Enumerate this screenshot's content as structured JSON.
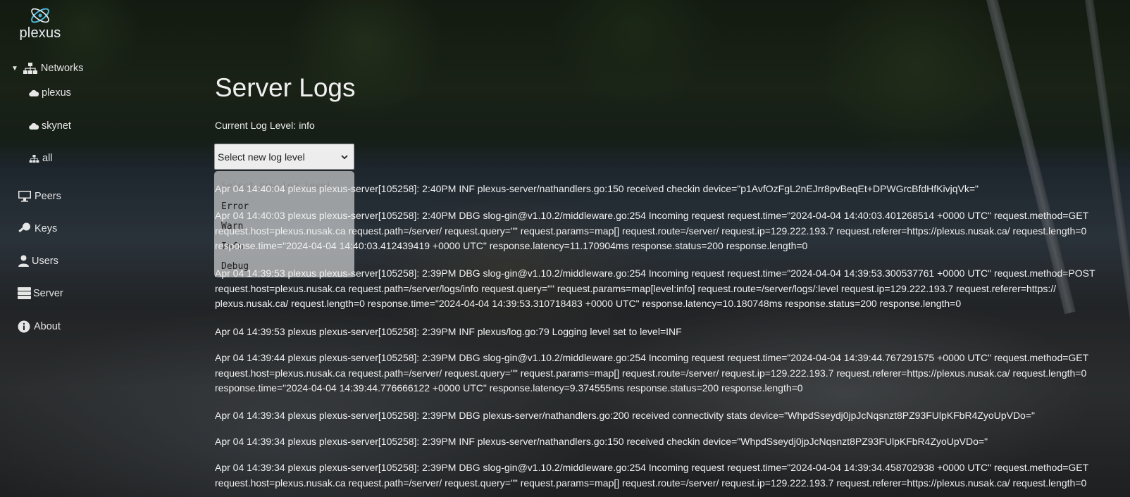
{
  "brand": {
    "name": "plexus"
  },
  "sidebar": {
    "networks_label": "Networks",
    "network_items": [
      "plexus",
      "skynet",
      "all"
    ],
    "items": [
      {
        "label": "Peers",
        "icon": "monitor-icon"
      },
      {
        "label": "Keys",
        "icon": "key-icon"
      },
      {
        "label": "Users",
        "icon": "user-icon"
      },
      {
        "label": "Server",
        "icon": "server-icon"
      },
      {
        "label": "About",
        "icon": "info-icon"
      }
    ]
  },
  "main": {
    "title": "Server Logs",
    "current_level_label": "Current Log Level:",
    "current_level_value": "info",
    "select": {
      "value": "Select new log level",
      "options": [
        "Select new log level",
        "Error",
        "Warn",
        "Info",
        "Debug"
      ]
    },
    "logs": [
      "Apr 04 14:40:04 plexus plexus-server[105258]: 2:40PM INF plexus-server/nathandlers.go:150 received checkin device=\"p1AvfOzFgL2nEJrr8pvBeqEt+DPWGrcBfdHfKivjqVk=\"",
      "Apr 04 14:40:03 plexus plexus-server[105258]: 2:40PM DBG slog-gin@v1.10.2/middleware.go:254 Incoming request request.time=\"2024-04-04 14:40:03.401268514 +0000 UTC\" request.method=GET request.host=plexus.nusak.ca request.path=/server/ request.query=\"\" request.params=map[] request.route=/server/ request.ip=129.222.193.7 request.referer=https://plexus.nusak.ca/ request.length=0 response.time=\"2024-04-04 14:40:03.412439419 +0000 UTC\" response.latency=11.170904ms response.status=200 response.length=0",
      "Apr 04 14:39:53 plexus plexus-server[105258]: 2:39PM DBG slog-gin@v1.10.2/middleware.go:254 Incoming request request.time=\"2024-04-04 14:39:53.300537761 +0000 UTC\" request.method=POST request.host=plexus.nusak.ca request.path=/server/logs/info request.query=\"\" request.params=map[level:info] request.route=/server/logs/:level request.ip=129.222.193.7 request.referer=https:// plexus.nusak.ca/ request.length=0 response.time=\"2024-04-04 14:39:53.310718483 +0000 UTC\" response.latency=10.180748ms response.status=200 response.length=0",
      "Apr 04 14:39:53 plexus plexus-server[105258]: 2:39PM INF plexus/log.go:79 Logging level set to level=INF",
      "Apr 04 14:39:44 plexus plexus-server[105258]: 2:39PM DBG slog-gin@v1.10.2/middleware.go:254 Incoming request request.time=\"2024-04-04 14:39:44.767291575 +0000 UTC\" request.method=GET request.host=plexus.nusak.ca request.path=/server/ request.query=\"\" request.params=map[] request.route=/server/ request.ip=129.222.193.7 request.referer=https://plexus.nusak.ca/ request.length=0 response.time=\"2024-04-04 14:39:44.776666122 +0000 UTC\" response.latency=9.374555ms response.status=200 response.length=0",
      "Apr 04 14:39:34 plexus plexus-server[105258]: 2:39PM DBG plexus-server/nathandlers.go:200 received connectivity stats device=\"WhpdSseydj0jpJcNqsnzt8PZ93FUlpKFbR4ZyoUpVDo=\"",
      "Apr 04 14:39:34 plexus plexus-server[105258]: 2:39PM INF plexus-server/nathandlers.go:150 received checkin device=\"WhpdSseydj0jpJcNqsnzt8PZ93FUlpKFbR4ZyoUpVDo=\"",
      "Apr 04 14:39:34 plexus plexus-server[105258]: 2:39PM DBG slog-gin@v1.10.2/middleware.go:254 Incoming request request.time=\"2024-04-04 14:39:34.458702938 +0000 UTC\" request.method=GET request.host=plexus.nusak.ca request.path=/server/ request.query=\"\" request.params=map[] request.route=/server/ request.ip=129.222.193.7 request.referer=https://plexus.nusak.ca/ request.length=0"
    ]
  }
}
